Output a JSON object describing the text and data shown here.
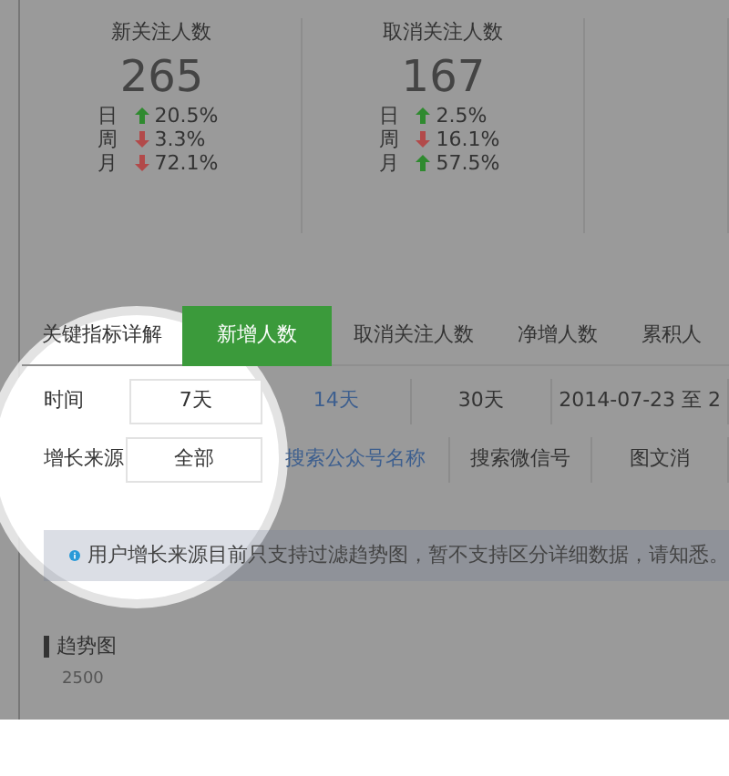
{
  "stats": [
    {
      "title": "新关注人数",
      "value": "265",
      "changes": [
        {
          "period": "日",
          "up": true,
          "value": "20.5%"
        },
        {
          "period": "周",
          "up": false,
          "value": "3.3%"
        },
        {
          "period": "月",
          "up": false,
          "value": "72.1%"
        }
      ]
    },
    {
      "title": "取消关注人数",
      "value": "167",
      "changes": [
        {
          "period": "日",
          "up": true,
          "value": "2.5%"
        },
        {
          "period": "周",
          "up": false,
          "value": "16.1%"
        },
        {
          "period": "月",
          "up": true,
          "value": "57.5%"
        }
      ]
    }
  ],
  "section_title": "关键指标详解",
  "tabs": [
    {
      "label": "新增人数",
      "selected": true
    },
    {
      "label": "取消关注人数",
      "selected": false
    },
    {
      "label": "净增人数",
      "selected": false
    },
    {
      "label": "累积人",
      "selected": false
    }
  ],
  "filters": [
    {
      "label": "时间",
      "options": [
        {
          "label": "7天",
          "selected": true
        },
        {
          "label": "14天",
          "selected": false
        },
        {
          "label": "30天",
          "selected": false
        },
        {
          "label": "2014-07-23 至 2",
          "selected": false
        }
      ]
    },
    {
      "label": "增长来源",
      "options": [
        {
          "label": "全部",
          "selected": true
        },
        {
          "label": "搜索公众号名称",
          "selected": false
        },
        {
          "label": "搜索微信号",
          "selected": false
        },
        {
          "label": "图文消",
          "selected": false
        }
      ]
    }
  ],
  "notice": "用户增长来源目前只支持过滤趋势图，暂不支持区分详细数据，请知悉。",
  "chart_title": "趋势图",
  "y_tick": "2500"
}
